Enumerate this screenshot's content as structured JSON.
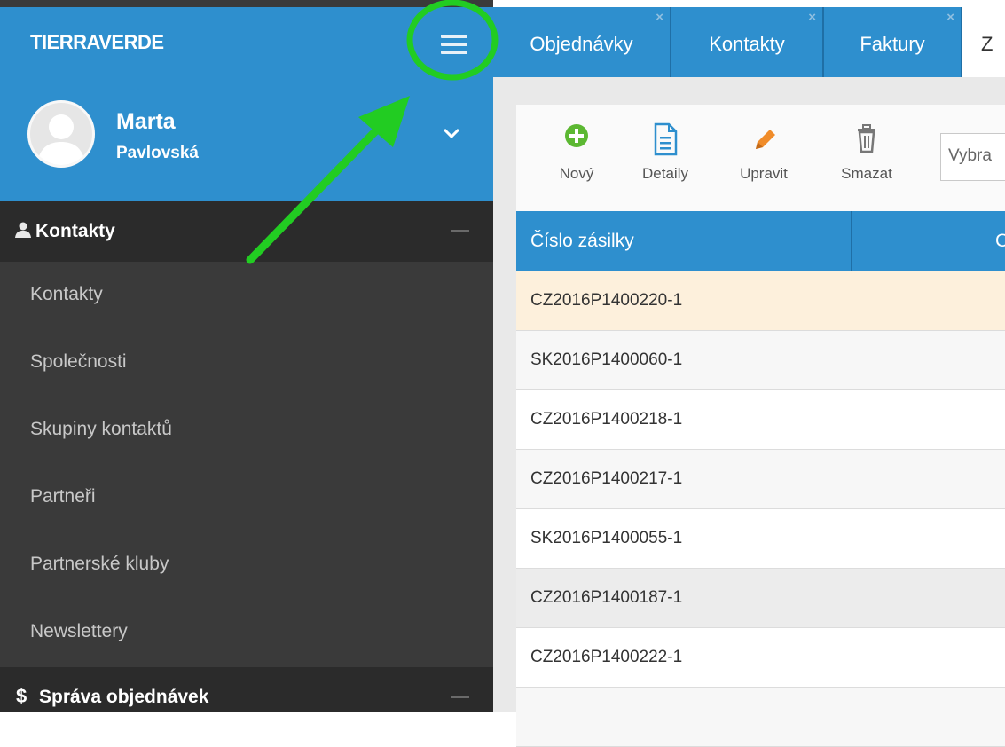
{
  "app": {
    "brand": "TIERRAVERDE"
  },
  "user": {
    "first_name": "Marta",
    "last_name": "Pavlovská"
  },
  "sidebar": {
    "sections": [
      {
        "title": "Kontakty"
      },
      {
        "title": "Správa objednávek"
      }
    ],
    "items": [
      {
        "label": "Kontakty"
      },
      {
        "label": "Společnosti"
      },
      {
        "label": "Skupiny kontaktů"
      },
      {
        "label": "Partneři"
      },
      {
        "label": "Partnerské kluby"
      },
      {
        "label": "Newslettery"
      }
    ]
  },
  "tabs": [
    {
      "label": "Objednávky",
      "close": "×"
    },
    {
      "label": "Kontakty",
      "close": "×"
    },
    {
      "label": "Faktury",
      "close": "×"
    },
    {
      "label": "Z"
    }
  ],
  "toolbar": {
    "new_label": "Nový",
    "details_label": "Detaily",
    "edit_label": "Upravit",
    "delete_label": "Smazat",
    "select_placeholder": "Vybra"
  },
  "table": {
    "columns": [
      "Číslo zásilky",
      "C"
    ],
    "rows": [
      {
        "number": "CZ2016P1400220-1",
        "selected": true
      },
      {
        "number": "SK2016P1400060-1"
      },
      {
        "number": "CZ2016P1400218-1"
      },
      {
        "number": "CZ2016P1400217-1"
      },
      {
        "number": "SK2016P1400055-1"
      },
      {
        "number": "CZ2016P1400187-1",
        "highlighted": true
      },
      {
        "number": "CZ2016P1400222-1"
      }
    ]
  },
  "colors": {
    "accent": "#2e8fce",
    "sidebar_bg": "#3a3a3a",
    "selected_row": "#fdf0dc",
    "annotation_green": "#22cc22",
    "icon_new": "#5cb832",
    "icon_edit": "#f08c2a",
    "icon_details": "#2e8fce",
    "icon_delete": "#777777"
  },
  "icons": {
    "menu": "hamburger-icon",
    "user_expand": "chevron-down-icon",
    "section_contacts": "user-icon",
    "section_orders": "dollar-icon",
    "new": "plus-circle-icon",
    "details": "document-icon",
    "edit": "pencil-icon",
    "delete": "trash-icon"
  }
}
